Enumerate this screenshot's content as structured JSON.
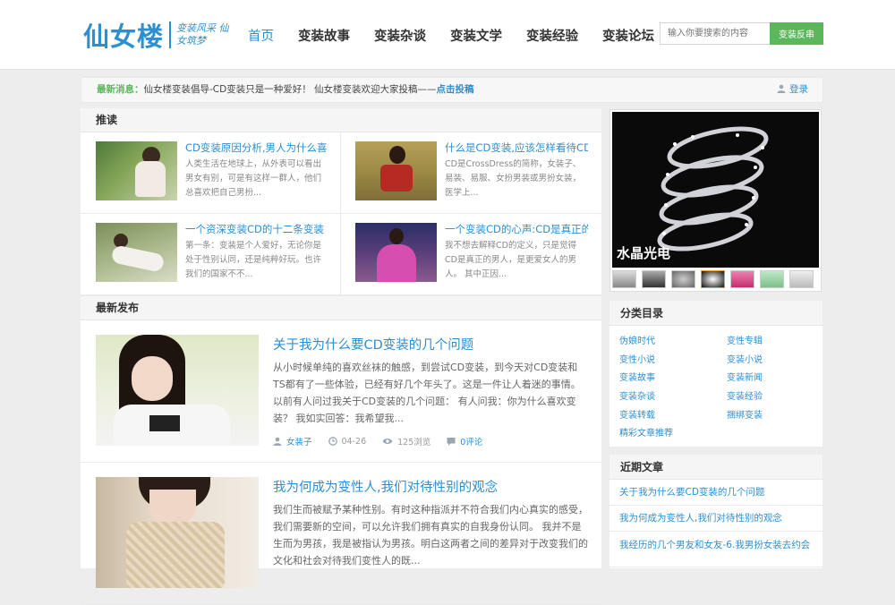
{
  "logo": {
    "main": "仙女楼",
    "sub": "变装风采 仙女筑梦"
  },
  "nav": [
    "首页",
    "变装故事",
    "变装杂谈",
    "变装文学",
    "变装经验",
    "变装论坛"
  ],
  "search": {
    "placeholder": "输入你要搜索的内容",
    "button": "变装反串"
  },
  "notice": {
    "tag": "最新消息：",
    "text": "仙女楼变装倡导-CD变装只是一种爱好！ 仙女楼变装欢迎大家投稿——",
    "link": "点击投稿",
    "login": "登录"
  },
  "recommend": {
    "title": "推读",
    "items": [
      {
        "title": "CD变装原因分析,男人为什么喜",
        "desc": "人类生活在地球上，从外表可以看出男女有别，可是有这样一群人，他们总喜欢把自己男扮..."
      },
      {
        "title": "什么是CD变装,应该怎样看待CD",
        "desc": "CD是CrossDress的简称，女装子、易装、易服、女扮男装或男扮女装，医学上..."
      },
      {
        "title": "一个资深变装CD的十二条变装",
        "desc": "第一条：变装是个人爱好，无论你是处于性别认同，还是纯粹好玩。也许我们的国家不不..."
      },
      {
        "title": "一个变装CD的心声:CD是真正的",
        "desc": "我不想去解释CD的定义，只是觉得CD是真正的男人，是更爱女人的男人。 其中正因..."
      }
    ]
  },
  "latest": {
    "title": "最新发布",
    "posts": [
      {
        "title": "关于我为什么要CD变装的几个问题",
        "desc": "从小时候单纯的喜欢丝袜的触感，到尝试CD变装，到今天对CD变装和TS都有了一些体验，已经有好几个年头了。这是一件让人着迷的事情。 以前有人问过我关于CD变装的几个问题： 有人问我：你为什么喜欢变装？ 我如实回答：我希望我...",
        "author": "女装子",
        "date": "04-26",
        "views": "125浏览",
        "comments": "0评论"
      },
      {
        "title": "我为何成为变性人,我们对待性别的观念",
        "desc": "我们生而被赋予某种性别。有时这种指派并不符合我们内心真实的感受，我们需要新的空间，可以允许我们拥有真实的自我身份认同。 我并不是生而为男孩，我是被指认为男孩。明白这两者之间的差异对于改变我们的文化和社会对待我们变性人的既...",
        "author": "",
        "date": "",
        "views": "",
        "comments": ""
      }
    ]
  },
  "banner": {
    "caption": "水晶光电"
  },
  "categories": {
    "title": "分类目录",
    "items": [
      "伪娘时代",
      "变性专辑",
      "变性小说",
      "变装小说",
      "变装故事",
      "变装新闻",
      "变装杂谈",
      "变装经验",
      "变装转载",
      "捆绑变装",
      "精彩文章推荐"
    ]
  },
  "recent": {
    "title": "近期文章",
    "items": [
      "关于我为什么要CD变装的几个问题",
      "我为何成为变性人,我们对待性别的观念",
      "我经历的几个男友和女友-6.我男扮女装去约会"
    ]
  },
  "colors": {
    "accent": "#2e8fd0",
    "green": "#5bb75b"
  }
}
